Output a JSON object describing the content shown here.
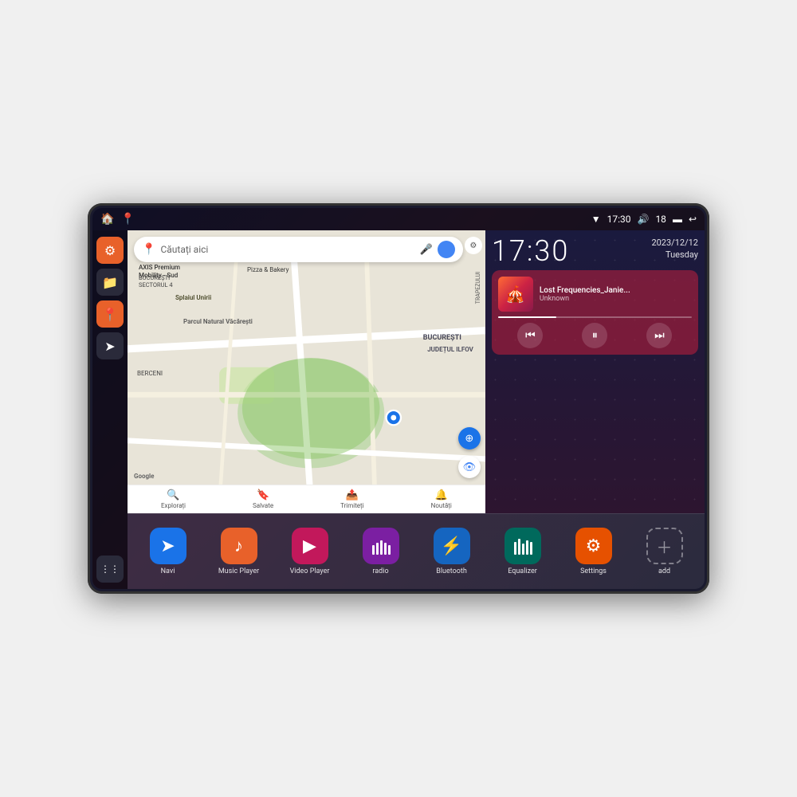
{
  "device": {
    "title": "Car Android Head Unit"
  },
  "statusBar": {
    "wifi_icon": "▼",
    "time": "17:30",
    "volume_icon": "🔊",
    "battery_icon": "18",
    "battery_bar": "▬",
    "back_icon": "↩"
  },
  "sidebar": {
    "home_label": "🏠",
    "map_label": "📍",
    "settings_label": "⚙",
    "folder_label": "📁",
    "location_label": "📍",
    "arrow_label": "➤",
    "grid_label": "⋮⋮⋮"
  },
  "map": {
    "search_placeholder": "Căutați aici",
    "search_pin": "📍",
    "label_axis": "AXIS Premium\nMobility - Sud",
    "label_pizza": "Pizza & Bakery",
    "label_trapez": "TRAPEZULUI",
    "label_parc": "Parcul Natural Văcărești",
    "label_buc": "BUCUREȘTI",
    "label_sector4": "SECTORUL 4",
    "label_ilfov": "JUDEȚUL ILFOV",
    "label_berceni": "BERCENI",
    "label_splai": "Splaiul Unirii",
    "bottom_explore": "Explorați",
    "bottom_saved": "Salvate",
    "bottom_share": "Trimiteți",
    "bottom_news": "Noutăți",
    "google_logo": "Google"
  },
  "clock": {
    "time": "17:30",
    "date": "2023/12/12",
    "day": "Tuesday"
  },
  "music": {
    "title": "Lost Frequencies_Janie...",
    "artist": "Unknown",
    "prev_icon": "⏮",
    "pause_icon": "⏸",
    "next_icon": "⏭"
  },
  "apps": [
    {
      "id": "navi",
      "label": "Navi",
      "icon": "➤",
      "color_class": "blue-nav"
    },
    {
      "id": "music-player",
      "label": "Music Player",
      "icon": "♪",
      "color_class": "red-music"
    },
    {
      "id": "video-player",
      "label": "Video Player",
      "icon": "▶",
      "color_class": "pink-video"
    },
    {
      "id": "radio",
      "label": "radio",
      "icon": "📻",
      "color_class": "purple-radio"
    },
    {
      "id": "bluetooth",
      "label": "Bluetooth",
      "icon": "⚡",
      "color_class": "blue-bt"
    },
    {
      "id": "equalizer",
      "label": "Equalizer",
      "icon": "🎚",
      "color_class": "teal-eq"
    },
    {
      "id": "settings",
      "label": "Settings",
      "icon": "⚙",
      "color_class": "orange-set"
    },
    {
      "id": "add",
      "label": "add",
      "icon": "＋",
      "color_class": "gray-add"
    }
  ]
}
